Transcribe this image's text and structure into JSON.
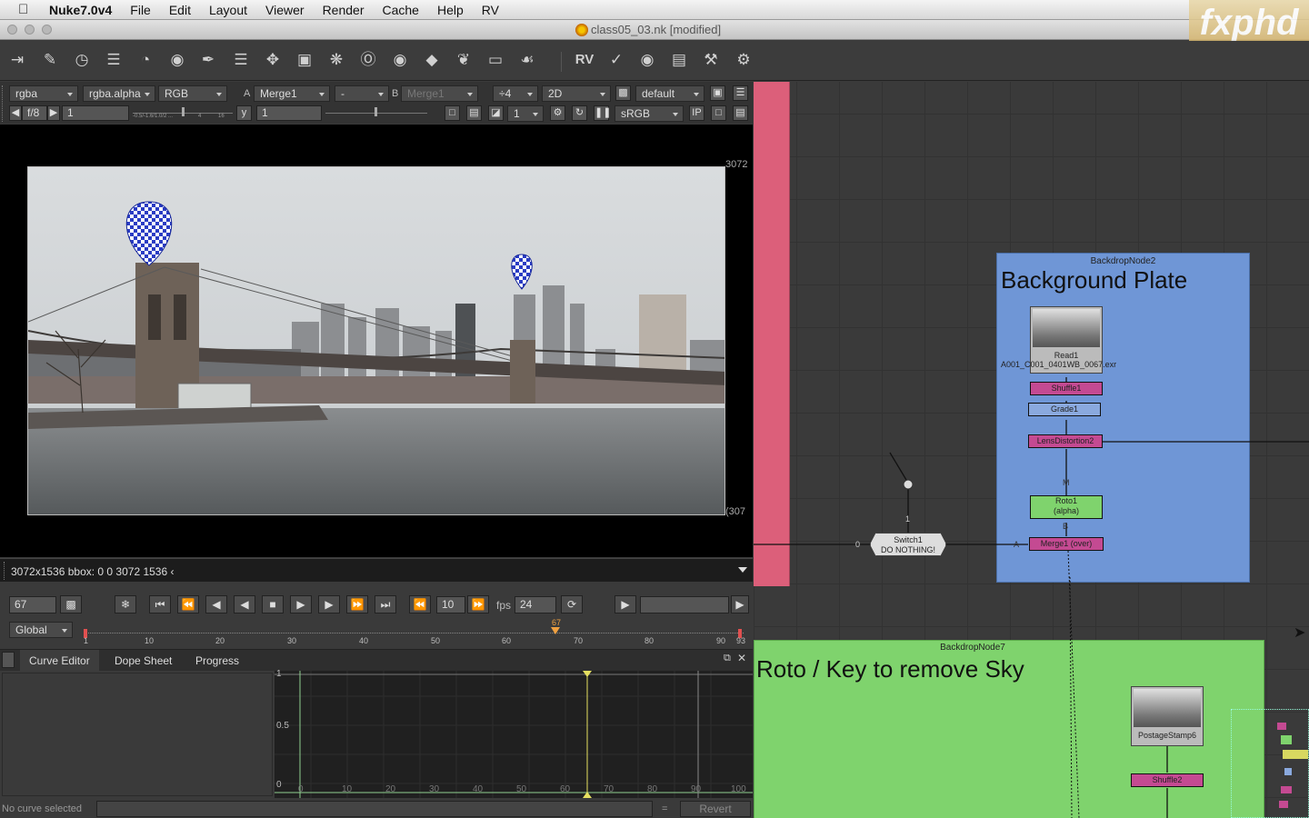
{
  "menubar": {
    "app": "Nuke7.0v4",
    "items": [
      "File",
      "Edit",
      "Layout",
      "Viewer",
      "Render",
      "Cache",
      "Help",
      "RV"
    ]
  },
  "window": {
    "title": "class05_03.nk [modified]"
  },
  "watermark": "fxphd",
  "toolbar": {
    "rv_label": "RV",
    "icons": [
      "import-icon",
      "paint-icon",
      "time-icon",
      "channel-icon",
      "color-icon",
      "filter-icon",
      "keyer-icon",
      "merge-icon",
      "transform-icon",
      "3d-icon",
      "particles-icon",
      "deep-icon",
      "views-icon",
      "metadata-icon",
      "toolsets-icon",
      "other-icon",
      "furnace-icon",
      "ocula-icon"
    ]
  },
  "viewer_controls": {
    "channels": "rgba",
    "alpha": "rgba.alpha",
    "display": "RGB",
    "a_label": "A",
    "a_input": "Merge1",
    "wipe": "-",
    "b_label": "B",
    "b_input": "Merge1",
    "downscale": "÷4",
    "mode": "2D",
    "lut_preset": "default",
    "fstop": "f/8",
    "gain": "1",
    "y_label": "y",
    "gamma": "1",
    "proxy_scale": "1",
    "colorspace": "sRGB",
    "ip_label": "IP",
    "gain_ticks": [
      "-0.5/-1.6/1.0/2 ...",
      "4",
      "16"
    ]
  },
  "viewer": {
    "format_top": "3072",
    "format_right": "(307"
  },
  "viewer_info": {
    "text": "3072x1536 bbox: 0 0 3072 1536 ‹"
  },
  "playbar": {
    "frame": "67",
    "increment": "10",
    "fps_label": "fps",
    "fps": "24"
  },
  "timeline": {
    "range_mode": "Global",
    "ticks": [
      "1",
      "10",
      "20",
      "30",
      "40",
      "50",
      "60",
      "70",
      "80",
      "90",
      "93"
    ],
    "current": "67"
  },
  "tabs": [
    {
      "label": "Curve Editor"
    },
    {
      "label": "Dope Sheet"
    },
    {
      "label": "Progress"
    }
  ],
  "curve_editor": {
    "y_ticks": [
      "1",
      "0.5",
      "0"
    ],
    "x_ticks": [
      "0",
      "10",
      "20",
      "30",
      "40",
      "50",
      "60",
      "70",
      "80",
      "90",
      "100"
    ],
    "status": "No curve selected",
    "equals": "=",
    "revert": "Revert"
  },
  "nodegraph": {
    "backdrop_bg": {
      "name": "BackdropNode2",
      "label": "Background Plate",
      "color": "#6f96d6"
    },
    "backdrop_roto": {
      "name": "BackdropNode7",
      "label": "Roto / Key to remove Sky",
      "color": "#7fd36d"
    },
    "read_label": "Read1",
    "read_file": "A001_C001_0401WB_0067.exr",
    "shuffle1": "Shuffle1",
    "grade1": "Grade1",
    "lensdist": "LensDistortion2",
    "roto1": "Roto1\n(alpha)",
    "merge1": "Merge1 (over)",
    "switch": "Switch1\nDO NOTHING!",
    "switch_input": "0",
    "switch_which": "1",
    "postage": "PostageStamp6",
    "shuffle2": "Shuffle2",
    "mask_label": "M",
    "b_label": "B",
    "a_label": "A"
  }
}
